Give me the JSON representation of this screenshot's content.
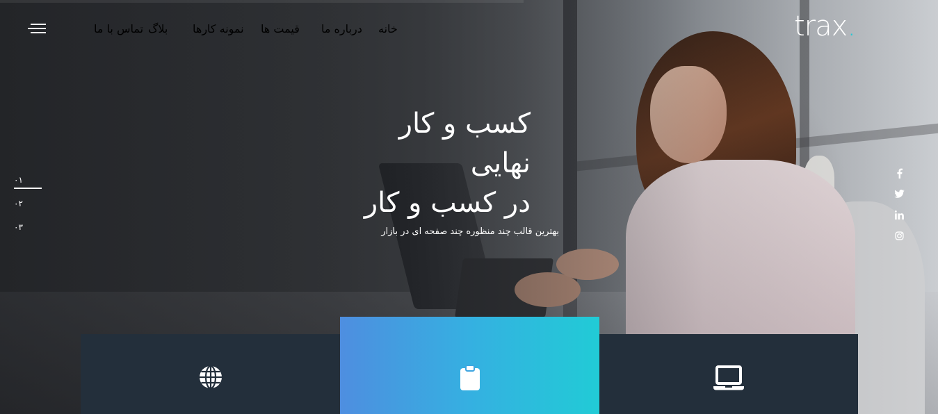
{
  "brand": {
    "logo_text": "trax",
    "logo_dot": ".",
    "accent_color": "#22c9d6"
  },
  "nav": {
    "items": [
      {
        "label": "خانه"
      },
      {
        "label": "درباره ما",
        "active": true
      },
      {
        "label": "قیمت ها"
      },
      {
        "label": "نمونه کارها"
      },
      {
        "label": "بلاگ"
      },
      {
        "label": "تماس با ما"
      }
    ],
    "menu_icon": "hamburger-menu-icon"
  },
  "hero": {
    "headline_line1": "کسب و کار",
    "headline_line2": "نهایی",
    "headline_line3": "در کسب و کار",
    "subtitle": "بهترین قالب چند منظوره چند صفحه ای در بازار"
  },
  "slider": {
    "indicators": [
      {
        "label": "۰۱",
        "active": true
      },
      {
        "label": "۰۲"
      },
      {
        "label": "۰۳"
      }
    ]
  },
  "social": {
    "icons": [
      "facebook-icon",
      "twitter-icon",
      "linkedin-icon",
      "instagram-icon"
    ]
  },
  "features": [
    {
      "icon": "globe-icon",
      "color": "#232f3b"
    },
    {
      "icon": "clipboard-icon",
      "gradient": [
        "#4e8ee0",
        "#21cbd6"
      ]
    },
    {
      "icon": "laptop-icon",
      "color": "#232f3b"
    }
  ]
}
